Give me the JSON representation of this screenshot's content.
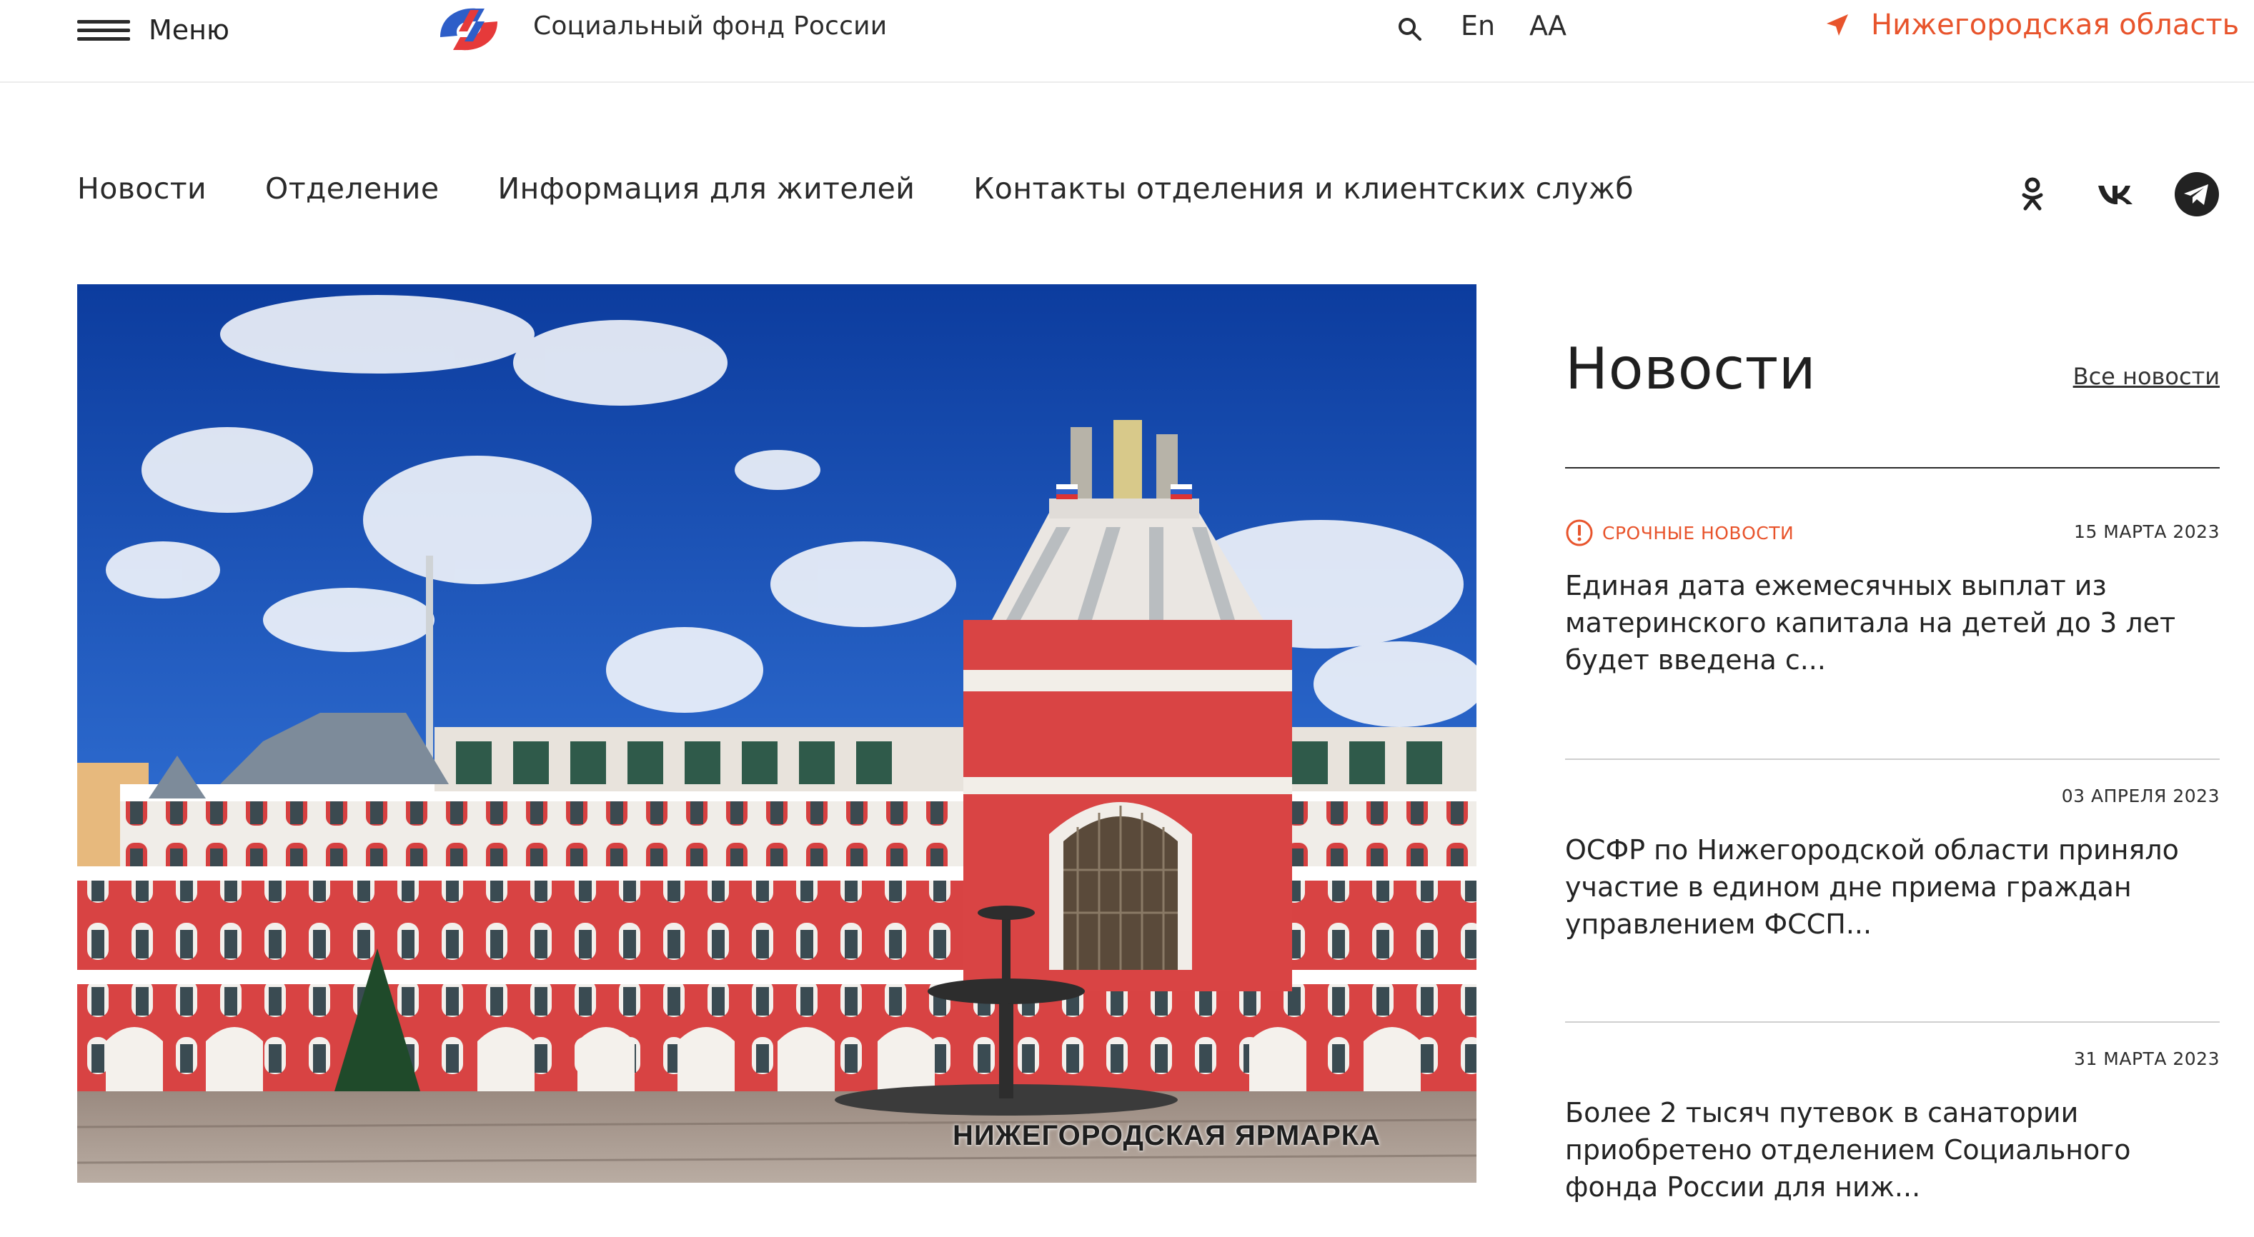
{
  "header": {
    "menu_label": "Меню",
    "brand_name": "Социальный фонд России",
    "lang_label": "En",
    "font_size_label": "АА",
    "region_label": "Нижегородская область",
    "accent_color": "#e8542c"
  },
  "icons": {
    "menu": "hamburger-icon",
    "logo": "sfr-logo",
    "search": "search-icon",
    "region": "location-arrow-icon",
    "ok": "odnoklassniki-icon",
    "vk": "vk-icon",
    "telegram": "telegram-icon",
    "urgent": "exclamation-circle-icon"
  },
  "nav": {
    "items": [
      {
        "label": "Новости"
      },
      {
        "label": "Отделение"
      },
      {
        "label": "Информация для жителей"
      },
      {
        "label": "Контакты отделения и клиентских служб"
      }
    ]
  },
  "hero": {
    "caption": "НИЖЕГОРОДСКАЯ ЯРМАРКА"
  },
  "news": {
    "title": "Новости",
    "all_link": "Все новости",
    "items": [
      {
        "tag": "СРОЧНЫЕ НОВОСТИ",
        "date": "15 МАРТА 2023",
        "headline": "Единая дата ежемесячных выплат из материнского капитала на детей до 3 лет будет введена с..."
      },
      {
        "tag": "",
        "date": "03 АПРЕЛЯ 2023",
        "headline": "ОСФР по Нижегородской области приняло участие в едином дне приема граждан управлением ФССП..."
      },
      {
        "tag": "",
        "date": "31 МАРТА 2023",
        "headline": "Более 2 тысяч путевок в санатории приобретено отделением Социального фонда России для ниж..."
      }
    ]
  }
}
